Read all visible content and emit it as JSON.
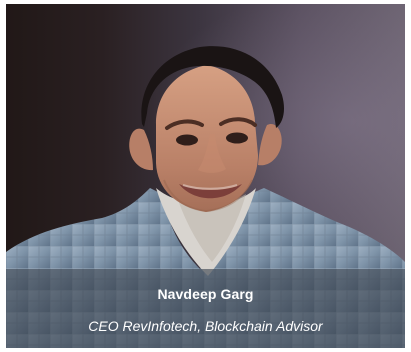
{
  "caption": {
    "name": "Navdeep Garg",
    "title": "CEO RevInfotech, Blockchain Advisor"
  },
  "colors": {
    "caption_band": "#3a424e",
    "caption_text": "#ffffff",
    "background_dark": "#211817",
    "background_light": "#6d6472",
    "jacket": "#8aa0b6",
    "shirt": "#d8d4cf",
    "skin": "#c89172",
    "hair": "#1a1414"
  },
  "icons": {
    "portrait": "person-photo"
  }
}
